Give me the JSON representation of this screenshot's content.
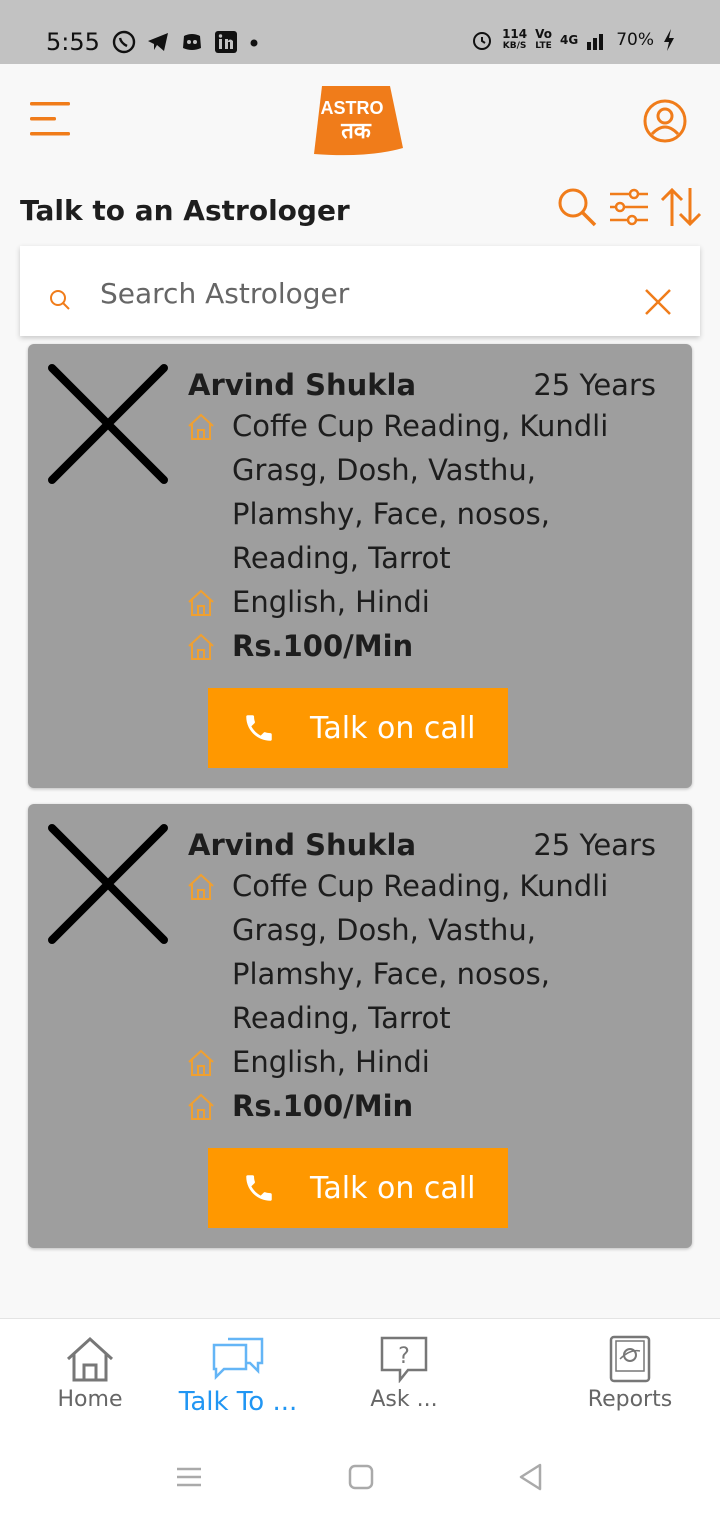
{
  "status_bar": {
    "time": "5:55",
    "net_speed": "114",
    "net_unit": "KB/S",
    "volte": "Vo",
    "volte2": "LTE",
    "network": "4G",
    "battery": "70%"
  },
  "header": {
    "logo_top": "ASTRO",
    "logo_bottom": "तक"
  },
  "page": {
    "title": "Talk to an Astrologer"
  },
  "search": {
    "placeholder": "Search Astrologer",
    "value": ""
  },
  "astrologers": [
    {
      "name": "Arvind Shukla",
      "experience": "25 Years",
      "skills": "Coffe Cup Reading, Kundli Grasg, Dosh, Vasthu, Plamshy, Face, nosos, Reading, Tarrot",
      "languages": "English, Hindi",
      "price": "Rs.100/Min",
      "call_label": "Talk on call"
    },
    {
      "name": "Arvind Shukla",
      "experience": "25 Years",
      "skills": "Coffe Cup Reading, Kundli Grasg, Dosh, Vasthu, Plamshy, Face, nosos, Reading, Tarrot",
      "languages": "English, Hindi",
      "price": "Rs.100/Min",
      "call_label": "Talk on call"
    }
  ],
  "bottom_nav": {
    "items": [
      {
        "label": "Home",
        "icon": "home-icon"
      },
      {
        "label": "Talk To ...",
        "icon": "chat-icon",
        "active": true
      },
      {
        "label": "Ask ...",
        "icon": "question-icon"
      },
      {
        "label": "Reports",
        "icon": "report-icon"
      }
    ]
  },
  "colors": {
    "accent": "#ff9800",
    "icon_orange": "#f07c1a",
    "card_bg": "#9e9e9e",
    "active_nav": "#2196f3"
  }
}
